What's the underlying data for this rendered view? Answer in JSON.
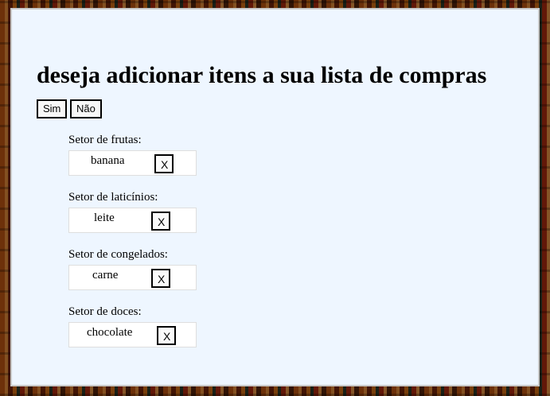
{
  "page": {
    "title": "deseja adicionar itens a sua lista de compras",
    "yes_label": "Sim",
    "no_label": "Não"
  },
  "sectors": [
    {
      "label": "Setor de frutas:",
      "item": "banana",
      "remove_label": "X"
    },
    {
      "label": "Setor de laticínios:",
      "item": "leite",
      "remove_label": "X"
    },
    {
      "label": "Setor de congelados:",
      "item": "carne",
      "remove_label": "X"
    },
    {
      "label": "Setor de doces:",
      "item": "chocolate",
      "remove_label": "X"
    }
  ],
  "colors": {
    "panel_background": "#eef6ff",
    "item_background": "#ffffff"
  }
}
